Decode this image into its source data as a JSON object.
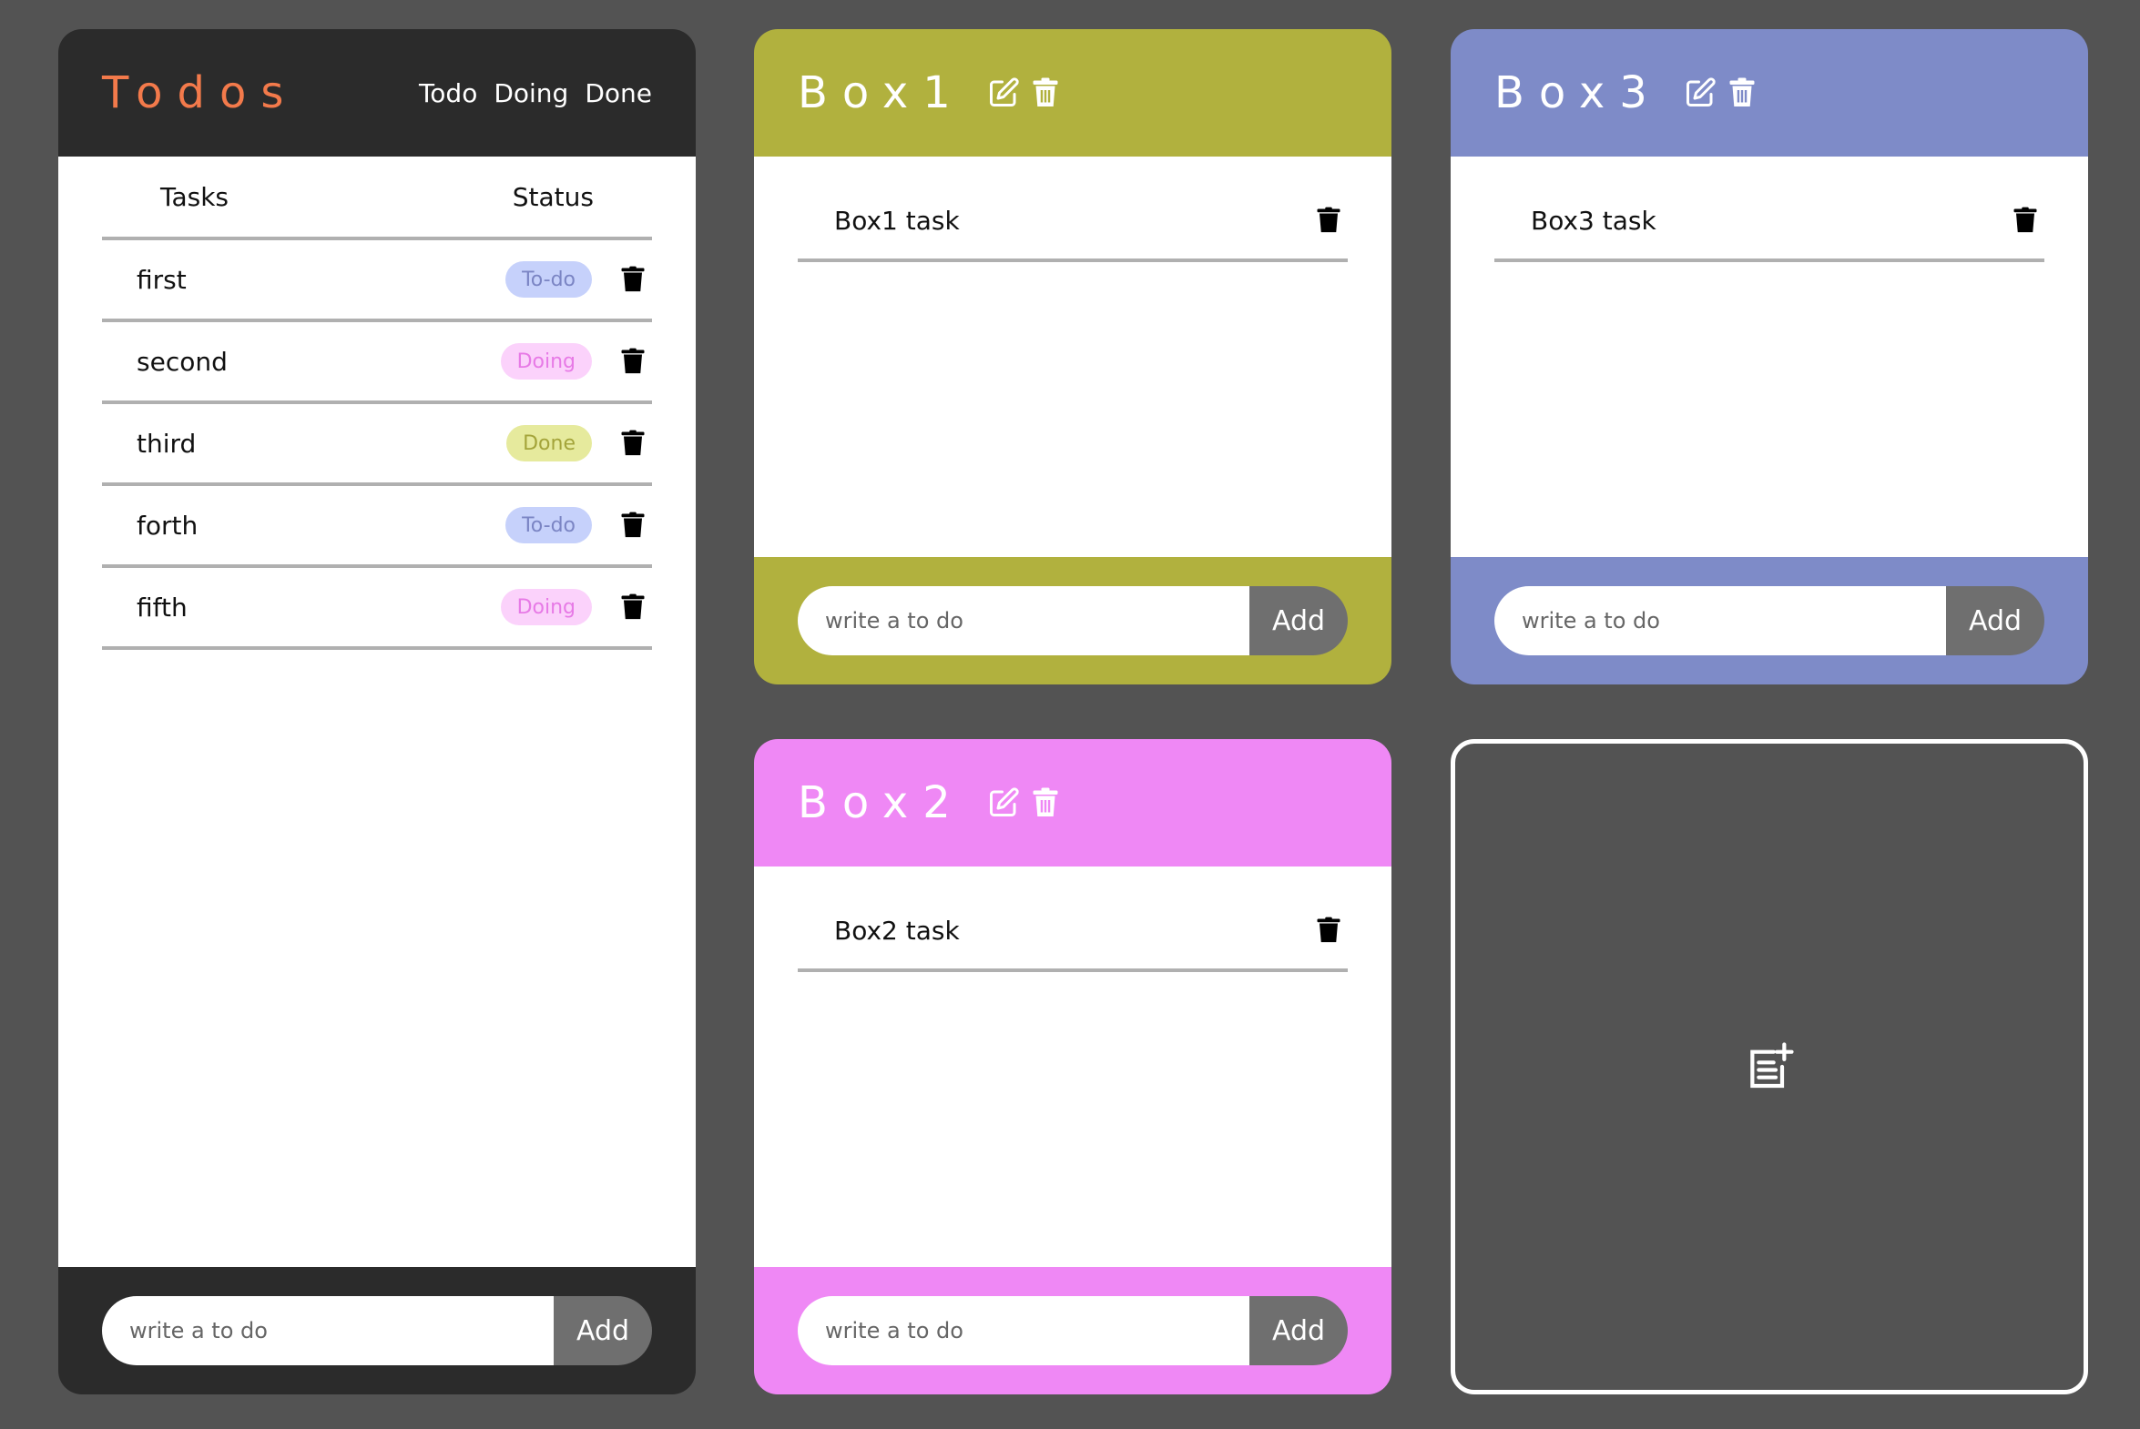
{
  "colors": {
    "background": "#535353",
    "todos_header": "#2b2b2b",
    "todos_title": "#f37a4b",
    "box1": "#b1b13e",
    "box2": "#ef88f5",
    "box3": "#7e8bc8",
    "badge_todo_bg": "#c6d1fb",
    "badge_todo_text": "#7b85c4",
    "badge_doing_bg": "#fbd2fb",
    "badge_doing_text": "#e77ae6",
    "badge_done_bg": "#e6ea9d",
    "badge_done_text": "#a4a43a",
    "add_button": "#6f6f6f"
  },
  "todos": {
    "title": "Todos",
    "filters": [
      "Todo",
      "Doing",
      "Done"
    ],
    "columns": {
      "tasks": "Tasks",
      "status": "Status"
    },
    "tasks": [
      {
        "label": "first",
        "status": "To-do",
        "kind": "todo"
      },
      {
        "label": "second",
        "status": "Doing",
        "kind": "doing"
      },
      {
        "label": "third",
        "status": "Done",
        "kind": "done"
      },
      {
        "label": "forth",
        "status": "To-do",
        "kind": "todo"
      },
      {
        "label": "fifth",
        "status": "Doing",
        "kind": "doing"
      }
    ],
    "input_placeholder": "write a to do",
    "add_label": "Add"
  },
  "boxes": [
    {
      "id": "box1",
      "title": "Box1",
      "task": "Box1 task",
      "input_placeholder": "write a to do",
      "add_label": "Add",
      "edit_icon": "edit-icon",
      "delete_icon": "trash-icon"
    },
    {
      "id": "box3",
      "title": "Box3",
      "task": "Box3 task",
      "input_placeholder": "write a to do",
      "add_label": "Add",
      "edit_icon": "edit-icon",
      "delete_icon": "trash-icon"
    },
    {
      "id": "box2",
      "title": "Box2",
      "task": "Box2 task",
      "input_placeholder": "write a to do",
      "add_label": "Add",
      "edit_icon": "edit-icon",
      "delete_icon": "trash-icon"
    }
  ],
  "new_box": {
    "icon": "note-add-icon"
  }
}
